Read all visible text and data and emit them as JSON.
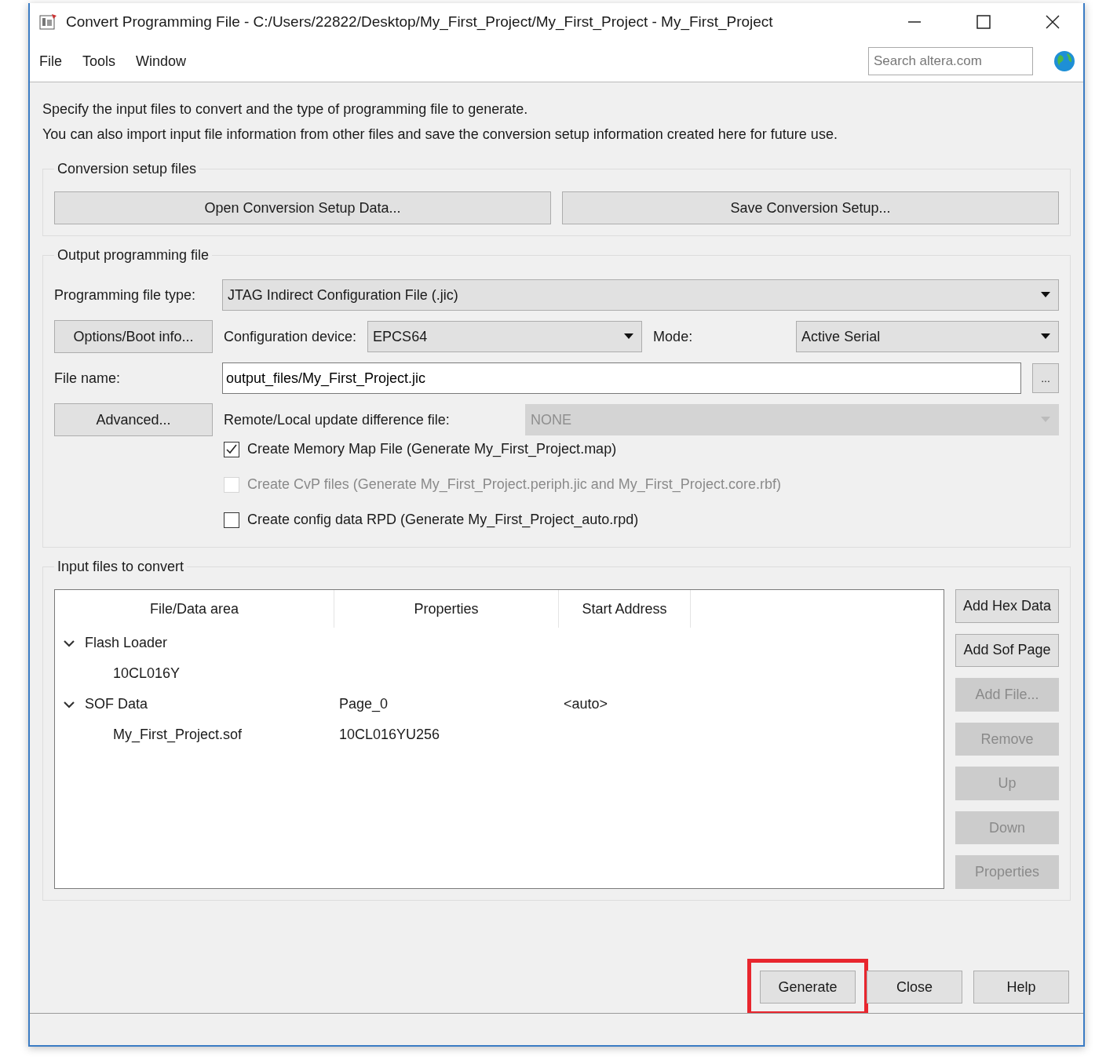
{
  "window": {
    "title": "Convert Programming File - C:/Users/22822/Desktop/My_First_Project/My_First_Project - My_First_Project"
  },
  "menu": [
    {
      "label": "File"
    },
    {
      "label": "Tools"
    },
    {
      "label": "Window"
    }
  ],
  "search": {
    "placeholder": "Search altera.com"
  },
  "intro": [
    "Specify the input files to convert and the type of programming file to generate.",
    "You can also import input file information from other files and save the conversion setup information created here for future use."
  ],
  "setup_section": {
    "title": "Conversion setup files",
    "buttons": [
      "Open Conversion Setup Data...",
      "Save Conversion Setup..."
    ]
  },
  "output_section": {
    "title": "Output programming file",
    "file_type": {
      "label": "Programming file type:",
      "value": "JTAG Indirect Configuration File (.jic)"
    },
    "options_button": "Options/Boot info...",
    "device": {
      "label": "Configuration device:",
      "value": "EPCS64"
    },
    "mode": {
      "label": "Mode:",
      "value": "Active Serial"
    },
    "file_name": {
      "label": "File name:",
      "value": "output_files/My_First_Project.jic",
      "browse": "..."
    },
    "advanced_button": "Advanced...",
    "remote_file": {
      "label": "Remote/Local update difference file:",
      "value": "NONE",
      "disabled": true
    },
    "checkboxes": [
      {
        "label": "Create Memory Map File (Generate My_First_Project.map)",
        "checked": true,
        "disabled": false
      },
      {
        "label": "Create CvP files (Generate My_First_Project.periph.jic and My_First_Project.core.rbf)",
        "checked": false,
        "disabled": true
      },
      {
        "label": "Create config data RPD (Generate My_First_Project_auto.rpd)",
        "checked": false,
        "disabled": false
      }
    ]
  },
  "input_section": {
    "title": "Input files to convert",
    "columns": [
      "File/Data area",
      "Properties",
      "Start Address"
    ],
    "tree": [
      {
        "name": "Flash Loader",
        "expanded": true,
        "children": [
          {
            "name": "10CL016Y"
          }
        ]
      },
      {
        "name": "SOF Data",
        "properties": "Page_0",
        "start_address": "<auto>",
        "expanded": true,
        "children": [
          {
            "name": "My_First_Project.sof",
            "properties": "10CL016YU256"
          }
        ]
      }
    ],
    "buttons": [
      {
        "label": "Add Hex Data",
        "disabled": false
      },
      {
        "label": "Add Sof Page",
        "disabled": false
      },
      {
        "label": "Add File...",
        "disabled": true
      },
      {
        "label": "Remove",
        "disabled": true
      },
      {
        "label": "Up",
        "disabled": true
      },
      {
        "label": "Down",
        "disabled": true
      },
      {
        "label": "Properties",
        "disabled": true
      }
    ]
  },
  "footer_buttons": [
    {
      "label": "Generate",
      "highlighted": true
    },
    {
      "label": "Close",
      "highlighted": false
    },
    {
      "label": "Help",
      "highlighted": false
    }
  ]
}
